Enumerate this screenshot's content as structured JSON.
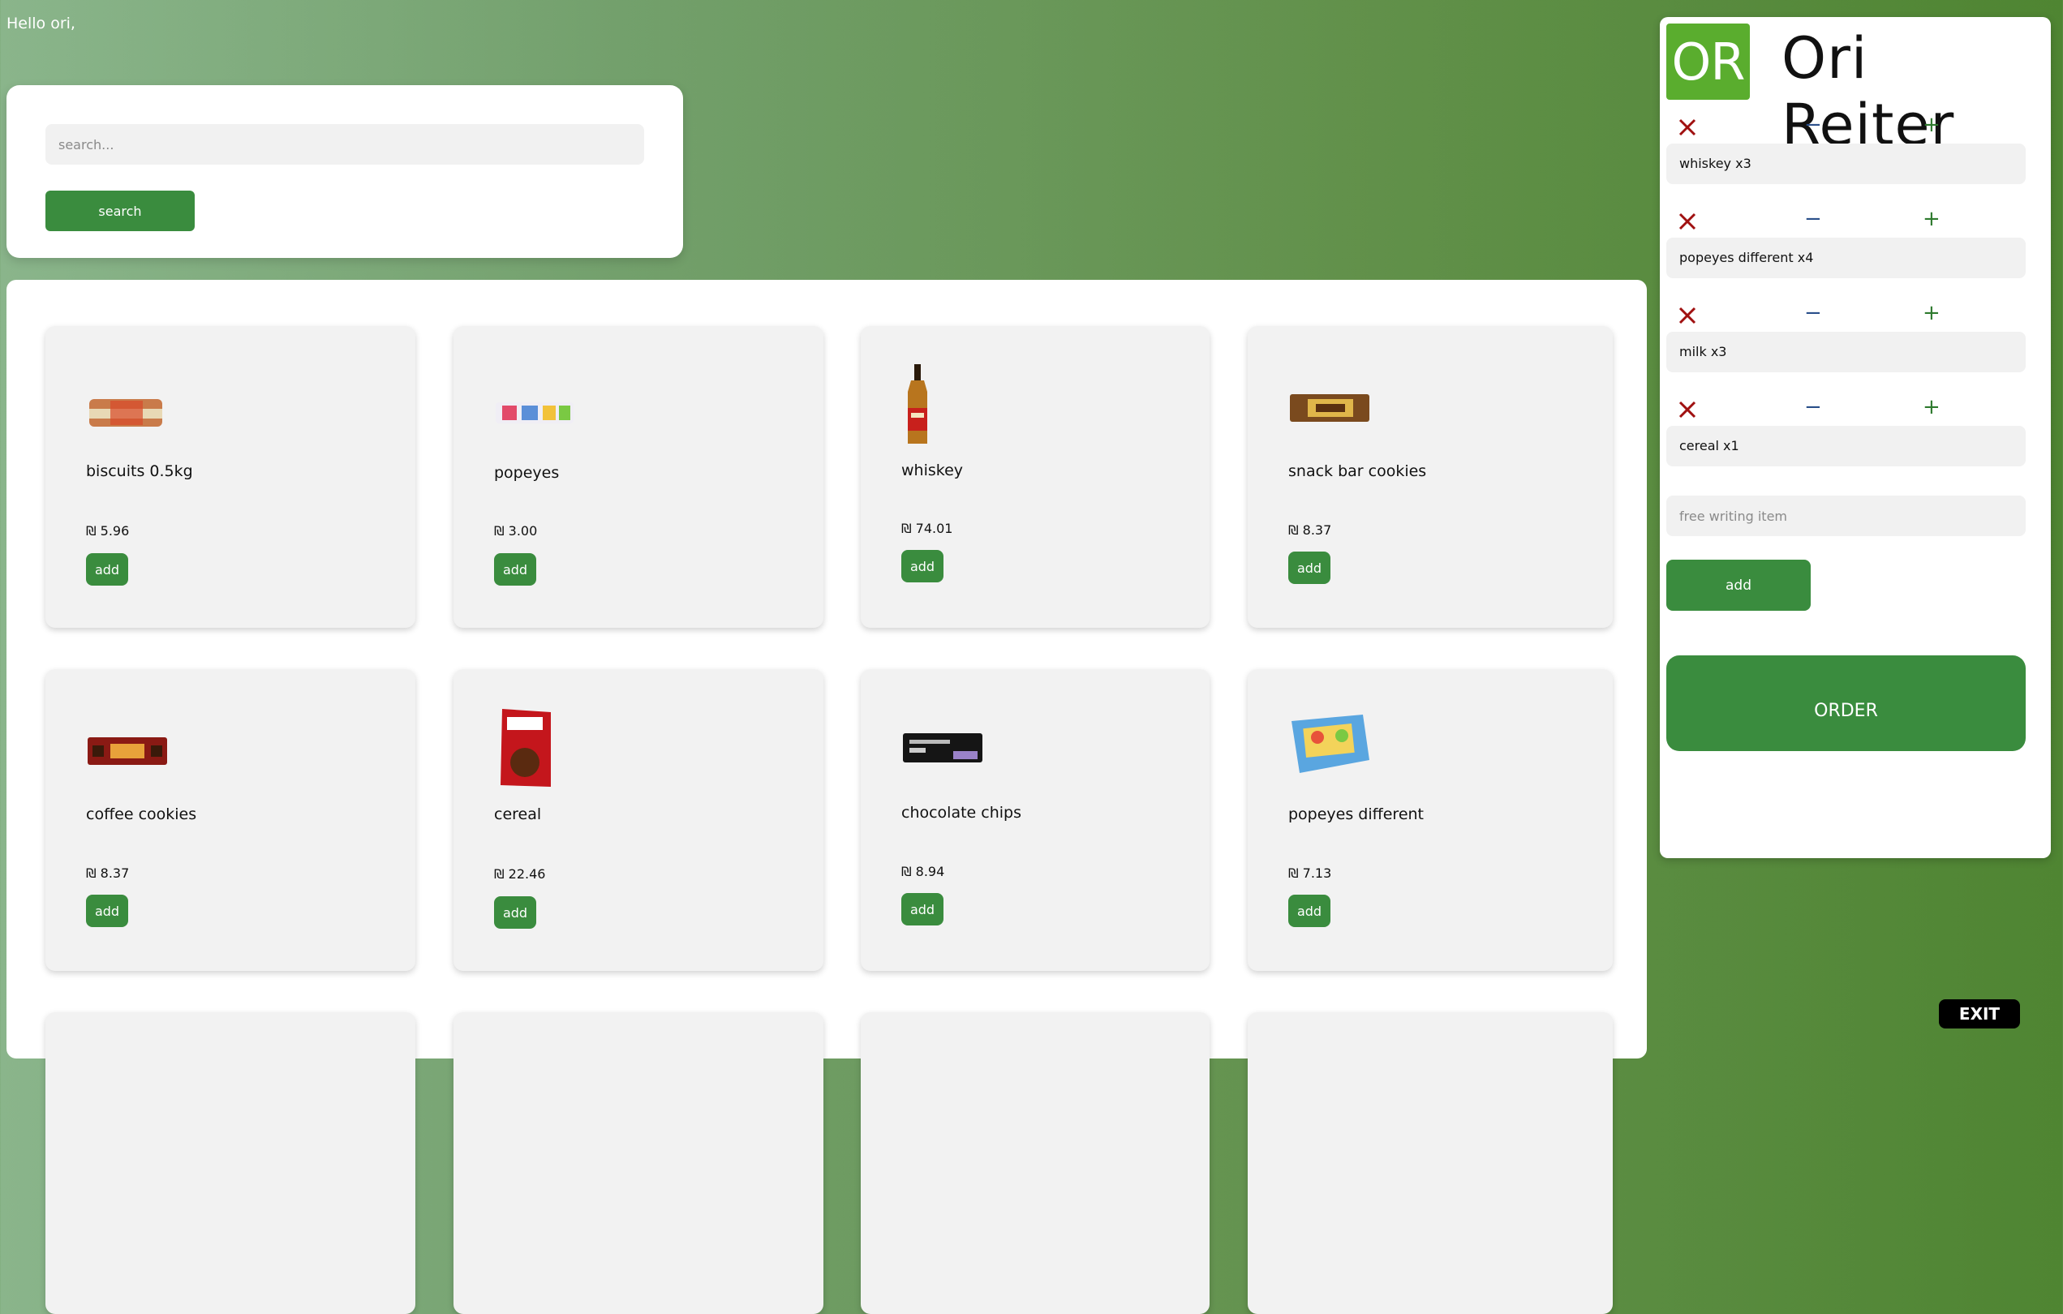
{
  "greeting": "Hello ori,",
  "search": {
    "placeholder": "search...",
    "button_label": "search"
  },
  "products": [
    {
      "name": "biscuits 0.5kg",
      "price": "₪ 5.96",
      "add_label": "add"
    },
    {
      "name": "popeyes",
      "price": "₪ 3.00",
      "add_label": "add"
    },
    {
      "name": "whiskey",
      "price": "₪ 74.01",
      "add_label": "add"
    },
    {
      "name": "snack bar cookies",
      "price": "₪ 8.37",
      "add_label": "add"
    },
    {
      "name": "coffee cookies",
      "price": "₪ 8.37",
      "add_label": "add"
    },
    {
      "name": "cereal",
      "price": "₪ 22.46",
      "add_label": "add"
    },
    {
      "name": "chocolate chips",
      "price": "₪ 8.94",
      "add_label": "add"
    },
    {
      "name": "popeyes different",
      "price": "₪ 7.13",
      "add_label": "add"
    }
  ],
  "cart": {
    "avatar_initials": "OR",
    "user_name": "Ori Reiter",
    "items": [
      {
        "label": "whiskey x3"
      },
      {
        "label": "popeyes different x4"
      },
      {
        "label": "milk x3"
      },
      {
        "label": "cereal x1"
      }
    ],
    "minus_symbol": "−",
    "plus_symbol": "+",
    "free_item_placeholder": "free writing item",
    "add_label": "add",
    "order_label": "ORDER"
  },
  "exit_label": "EXIT",
  "colors": {
    "accent_green": "#3a8c3e",
    "avatar_green": "#5aad2e",
    "remove_red": "#a01010"
  }
}
